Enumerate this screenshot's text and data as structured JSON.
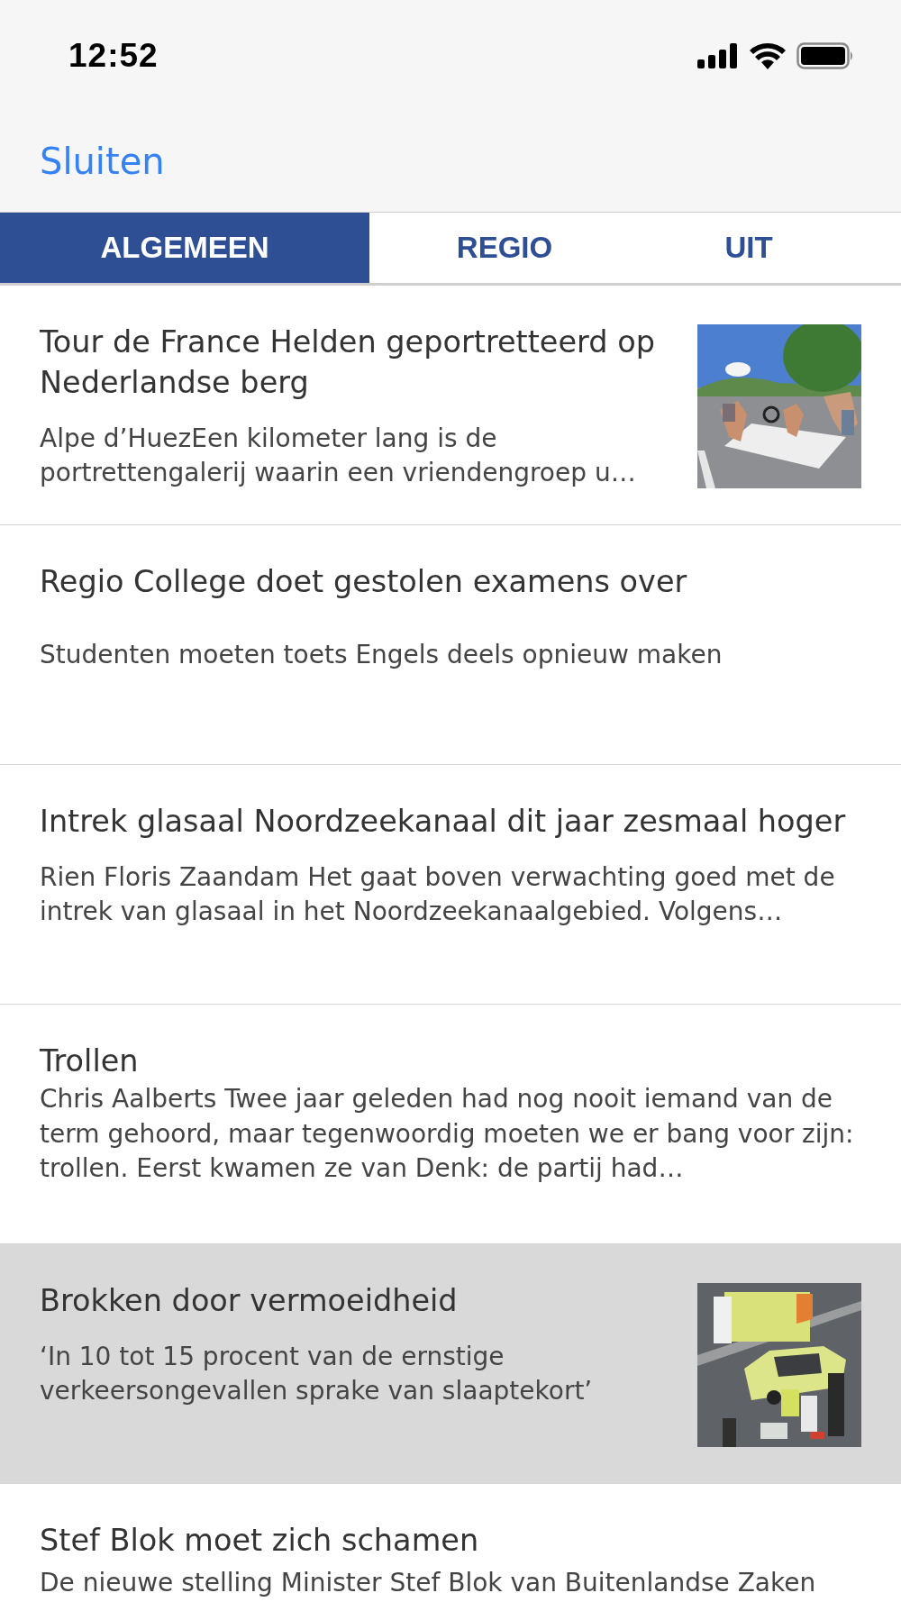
{
  "status_bar": {
    "time": "12:52"
  },
  "nav_bar": {
    "close_button": "Sluiten"
  },
  "tabs": [
    {
      "label": "ALGEMEEN",
      "selected": true
    },
    {
      "label": "REGIO",
      "selected": false
    },
    {
      "label": "UIT",
      "selected": false
    }
  ],
  "articles": [
    {
      "title": "Tour de France Helden geportretteerd op Nederlandse berg",
      "description": "Alpe d’HuezEen kilometer lang is de portrettengalerij waarin een vriendengroep u…",
      "selected": false
    },
    {
      "title": "Regio College doet gestolen examens over",
      "description": "Studenten moeten toets Engels deels opnieuw maken",
      "selected": false
    },
    {
      "title": "Intrek glasaal Noordzeekanaal dit jaar zesmaal hoger",
      "description": "Rien Floris Zaandam Het gaat boven verwachting goed met de intrek van glasaal in het Noordzeekanaalgebied. Volgens…",
      "selected": false
    },
    {
      "title": "Trollen",
      "description": "Chris Aalberts Twee jaar geleden had nog nooit iemand van de term gehoord, maar tegenwoordig moeten we er bang voor zijn: trollen. Eerst kwamen ze van Denk: de partij had…",
      "selected": false
    },
    {
      "title": "Brokken door vermoeidheid",
      "description": "‘In 10 tot 15 procent van de ernstige verkeersongevallen sprake van slaaptekort’",
      "selected": true
    },
    {
      "title": "Stef Blok moet zich schamen",
      "description": "De nieuwe stelling Minister Stef Blok van Buitenlandse Zaken",
      "selected": false
    }
  ]
}
